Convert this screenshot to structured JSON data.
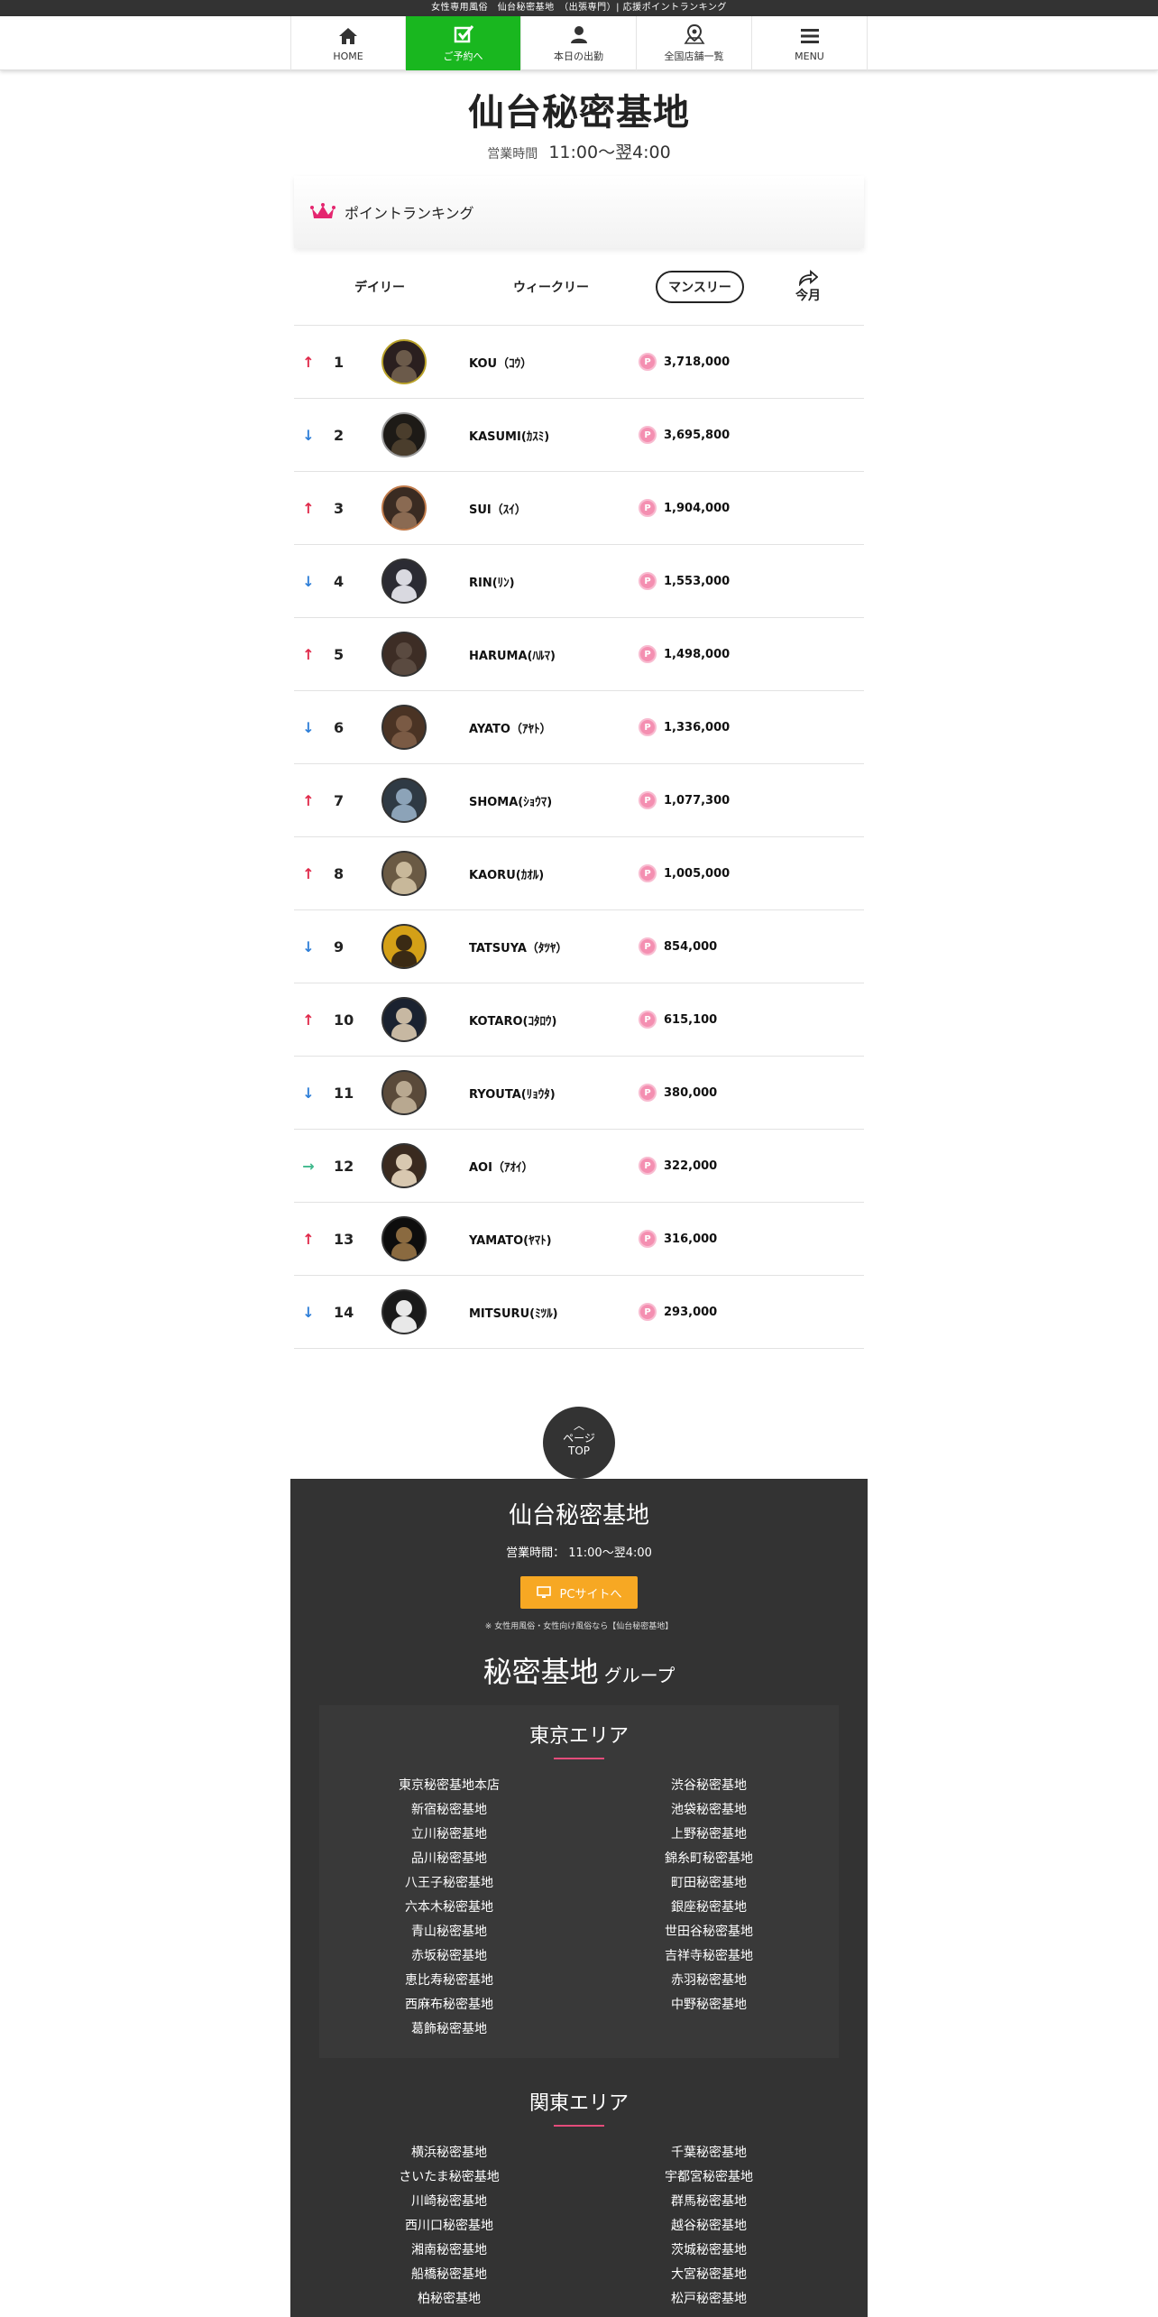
{
  "topbar": {
    "text": "女性専用風俗　仙台秘密基地　（出張専門）| 応援ポイントランキング"
  },
  "nav": [
    {
      "label": "HOME",
      "icon": "home-icon"
    },
    {
      "label": "ご予約へ",
      "icon": "reserve-check-icon"
    },
    {
      "label": "本日の出勤",
      "icon": "person-icon"
    },
    {
      "label": "全国店舗一覧",
      "icon": "map-pin-icon"
    },
    {
      "label": "MENU",
      "icon": "menu-icon"
    }
  ],
  "shop": {
    "title": "仙台秘密基地",
    "hours_label": "営業時間",
    "hours": "11:00〜翌4:00"
  },
  "ranking": {
    "heading": "ポイントランキング",
    "tabs": {
      "daily": "デイリー",
      "weekly": "ウィークリー",
      "monthly": "マンスリー",
      "share": "今月"
    },
    "rows": [
      {
        "trend": "↑",
        "rank": "1",
        "name": "KOU（ｺｳ）",
        "points": "3,718,000"
      },
      {
        "trend": "↓",
        "rank": "2",
        "name": "KASUMI(ｶｽﾐ)",
        "points": "3,695,800"
      },
      {
        "trend": "↑",
        "rank": "3",
        "name": "SUI（ｽｲ）",
        "points": "1,904,000"
      },
      {
        "trend": "↓",
        "rank": "4",
        "name": "RIN(ﾘﾝ)",
        "points": "1,553,000"
      },
      {
        "trend": "↑",
        "rank": "5",
        "name": "HARUMA(ﾊﾙﾏ)",
        "points": "1,498,000"
      },
      {
        "trend": "↓",
        "rank": "6",
        "name": "AYATO（ｱﾔﾄ）",
        "points": "1,336,000"
      },
      {
        "trend": "↑",
        "rank": "7",
        "name": "SHOMA(ｼｮｳﾏ)",
        "points": "1,077,300"
      },
      {
        "trend": "↑",
        "rank": "8",
        "name": "KAORU(ｶｵﾙ)",
        "points": "1,005,000"
      },
      {
        "trend": "↓",
        "rank": "9",
        "name": "TATSUYA（ﾀﾂﾔ）",
        "points": "854,000"
      },
      {
        "trend": "↑",
        "rank": "10",
        "name": "KOTARO(ｺﾀﾛｳ)",
        "points": "615,100"
      },
      {
        "trend": "↓",
        "rank": "11",
        "name": "RYOUTA(ﾘｮｳﾀ)",
        "points": "380,000"
      },
      {
        "trend": "→",
        "rank": "12",
        "name": "AOI（ｱｵｲ）",
        "points": "322,000"
      },
      {
        "trend": "↑",
        "rank": "13",
        "name": "YAMATO(ﾔﾏﾄ)",
        "points": "316,000"
      },
      {
        "trend": "↓",
        "rank": "14",
        "name": "MITSURU(ﾐﾂﾙ)",
        "points": "293,000"
      }
    ],
    "point_icon_text": "P"
  },
  "pagetop": {
    "line1": "ページ",
    "line2": "TOP"
  },
  "footer": {
    "title": "仙台秘密基地",
    "hours": "営業時間：  11:00～翌4:00",
    "pc_button": "PCサイトへ",
    "note": "※ 女性用風俗・女性向け風俗なら【仙台秘密基地】",
    "group_title": "秘密基地",
    "group_suffix": "グループ",
    "tokyo": {
      "title": "東京エリア",
      "left": [
        "東京秘密基地本店",
        "新宿秘密基地",
        "立川秘密基地",
        "品川秘密基地",
        "八王子秘密基地",
        "六本木秘密基地",
        "青山秘密基地",
        "赤坂秘密基地",
        "恵比寿秘密基地",
        "西麻布秘密基地",
        "葛飾秘密基地"
      ],
      "right": [
        "渋谷秘密基地",
        "池袋秘密基地",
        "上野秘密基地",
        "錦糸町秘密基地",
        "町田秘密基地",
        "銀座秘密基地",
        "世田谷秘密基地",
        "吉祥寺秘密基地",
        "赤羽秘密基地",
        "中野秘密基地"
      ]
    },
    "kanto": {
      "title": "関東エリア",
      "left": [
        "横浜秘密基地",
        "さいたま秘密基地",
        "川崎秘密基地",
        "西川口秘密基地",
        "湘南秘密基地",
        "船橋秘密基地",
        "柏秘密基地"
      ],
      "right": [
        "千葉秘密基地",
        "宇都宮秘密基地",
        "群馬秘密基地",
        "越谷秘密基地",
        "茨城秘密基地",
        "大宮秘密基地",
        "松戸秘密基地"
      ]
    }
  },
  "colors": {
    "accent_green": "#19b71f",
    "up_red": "#e0294a",
    "down_blue": "#2f7fd8",
    "flat_green": "#3fb88c",
    "pc_orange": "#f7a823",
    "footer_bg": "#333333"
  }
}
